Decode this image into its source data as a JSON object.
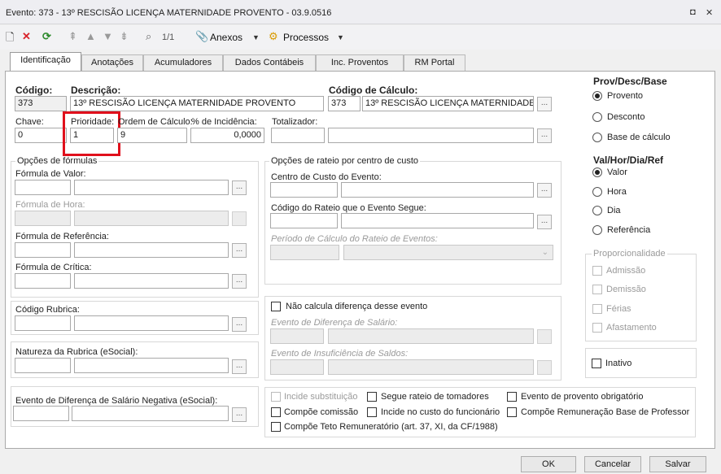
{
  "window": {
    "title": "Evento: 373 - 13º RESCISÃO LICENÇA MATERNIDADE PROVENTO - 03.9.0516",
    "ctl_restore": "◘",
    "ctl_close": "✕"
  },
  "toolbar": {
    "nav_count": "1/1",
    "anexos": "Anexos",
    "processos": "Processos"
  },
  "tabs": [
    "Identificação",
    "Anotações",
    "Acumuladores",
    "Dados Contábeis",
    "Inc. Proventos",
    "RM Portal"
  ],
  "ident": {
    "codigo_label": "Código:",
    "codigo_value": "373",
    "descricao_label": "Descrição:",
    "descricao_value": "13º RESCISÃO LICENÇA MATERNIDADE PROVENTO",
    "codcalc_label": "Código de Cálculo:",
    "codcalc_code": "373",
    "codcalc_desc": "13º RESCISÃO LICENÇA MATERNIDADE PROVENTO",
    "chave_label": "Chave:",
    "chave_value": "0",
    "prioridade_label": "Prioridade:",
    "prioridade_value": "1",
    "ordem_label": "Ordem de Cálculo:",
    "ordem_value": "9",
    "incidencia_label": "% de Incidência:",
    "incidencia_value": "0,0000",
    "totalizador_label": "Totalizador:"
  },
  "formulas": {
    "title": "Opções de fórmulas",
    "valor": "Fórmula de Valor:",
    "hora": "Fórmula de Hora:",
    "referencia": "Fórmula de Referência:",
    "critica": "Fórmula de Crítica:"
  },
  "rubrica": {
    "codigo": "Código Rubrica:",
    "natureza": "Natureza da Rubrica (eSocial):",
    "diferenca_negativa": "Evento de Diferença de Salário Negativa (eSocial):"
  },
  "rateio": {
    "title": "Opções de rateio por centro de custo",
    "centro": "Centro de Custo do Evento:",
    "codigo": "Código do Rateio que o Evento Segue:",
    "periodo": "Período de Cálculo do Rateio de Eventos:"
  },
  "diferenca": {
    "nao_calcula": "Não calcula diferença desse evento",
    "evento_dif": "Evento de Diferença de Salário:",
    "evento_insuf": "Evento de Insuficiência de Saldos:"
  },
  "checks": {
    "incide_subst": "Incide substituição",
    "segue_rateio": "Segue rateio de tomadores",
    "evento_obrig": "Evento de provento obrigatório",
    "compoe_comissao": "Compõe comissão",
    "incide_custo": "Incide no custo do funcionário",
    "compoe_base_prof": "Compõe Remuneração Base de Professor",
    "compoe_teto": "Compõe Teto Remuneratório (art. 37, XI, da CF/1988)"
  },
  "prov": {
    "title": "Prov/Desc/Base",
    "options": [
      "Provento",
      "Desconto",
      "Base de cálculo"
    ],
    "selected": 0
  },
  "val": {
    "title": "Val/Hor/Dia/Ref",
    "options": [
      "Valor",
      "Hora",
      "Dia",
      "Referência"
    ],
    "selected": 0
  },
  "proporc": {
    "title": "Proporcionalidade",
    "options": [
      "Admissão",
      "Demissão",
      "Férias",
      "Afastamento"
    ]
  },
  "inativo": "Inativo",
  "footer": {
    "ok": "OK",
    "cancelar": "Cancelar",
    "salvar": "Salvar"
  }
}
